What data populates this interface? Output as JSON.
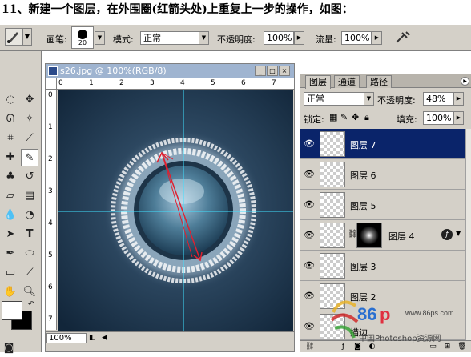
{
  "caption": "11、新建一个图层，在外围圈(红箭头处)上重复上一步的操作，如图：",
  "options_bar": {
    "brush_label": "画笔:",
    "brush_size": "20",
    "mode_label": "模式:",
    "mode_value": "正常",
    "opacity_label": "不透明度:",
    "opacity_value": "100%",
    "flow_label": "流量:",
    "flow_value": "100%"
  },
  "document": {
    "title": "s26.jpg @ 100%(RGB/8)",
    "zoom": "100%",
    "ruler_h": [
      "0",
      "1",
      "2",
      "3",
      "4",
      "5",
      "6",
      "7"
    ],
    "ruler_v": [
      "0",
      "1",
      "2",
      "3",
      "4",
      "5",
      "6",
      "7"
    ]
  },
  "layers_panel": {
    "tabs": [
      "图层",
      "通道",
      "路径"
    ],
    "blend_mode": "正常",
    "opacity_label": "不透明度:",
    "opacity_value": "48%",
    "lock_label": "锁定:",
    "fill_label": "填充:",
    "fill_value": "100%",
    "layers": [
      {
        "name": "图层 7",
        "visible": true,
        "selected": true
      },
      {
        "name": "图层 6",
        "visible": true,
        "selected": false
      },
      {
        "name": "图层 5",
        "visible": true,
        "selected": false
      },
      {
        "name": "图层 4",
        "visible": true,
        "selected": false,
        "has_mask": true
      },
      {
        "name": "图层 3",
        "visible": true,
        "selected": false
      },
      {
        "name": "图层 2",
        "visible": true,
        "selected": false
      },
      {
        "name": "描边",
        "visible": true,
        "selected": false
      }
    ]
  },
  "watermark": {
    "brand": "86ps.com",
    "text": "中国Photoshop资源网",
    "url": "www.86ps.com"
  },
  "colors": {
    "selected_layer": "#0a246a",
    "panel_bg": "#d4d0c8",
    "guide": "#40e0ff",
    "arrow": "#e02030"
  }
}
